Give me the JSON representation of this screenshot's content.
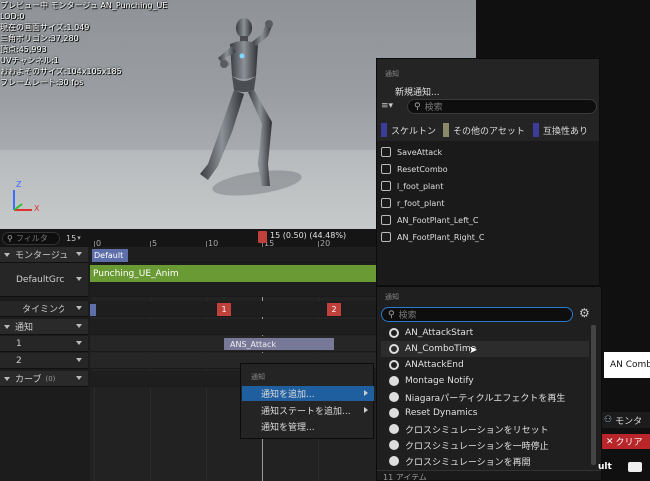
{
  "viewport": {
    "stats": [
      "プレビュー中 モンタージュ AN_Punching_UE",
      "LOD:0",
      "現在の画面サイズ:1.049",
      "三角ポリゴン:37,280",
      "頂点:45,993",
      "UVチャンネル:1",
      "おおよそのサイズ:104x105x185",
      "フレームレート:30 fps"
    ],
    "axis_labels": {
      "z": "Z",
      "x": "X"
    }
  },
  "tracks": {
    "filter_placeholder": "フィルタ",
    "frame_field": "15",
    "items": [
      {
        "label": "モンタージュ"
      },
      {
        "label": "DefaultGrc"
      },
      {
        "label": "タイミング"
      },
      {
        "label": "通知"
      },
      {
        "label": "1"
      },
      {
        "label": "2"
      },
      {
        "label": "カーブ",
        "count": "(0)"
      }
    ]
  },
  "timeline": {
    "ticks": [
      "0",
      "5",
      "10",
      "15",
      "20"
    ],
    "playhead_readout": "15 (0.50) (44.48%)",
    "section_label": "Default",
    "slot_clip": "Punching_UE_Anim",
    "timing_markers": [
      "1",
      "2"
    ],
    "state_notify": "ANS_Attack"
  },
  "notify_panel": {
    "header": "通知",
    "new_notify": "新規通知...",
    "search_placeholder": "検索",
    "filters": [
      {
        "label": "スケルトン",
        "color": "#3c3c9a"
      },
      {
        "label": "その他のアセット",
        "color": "#8a8a6a"
      },
      {
        "label": "互換性あり",
        "color": "#3c3c9a"
      }
    ],
    "items": [
      "SaveAttack",
      "ResetCombo",
      "l_foot_plant",
      "r_foot_plant",
      "AN_FootPlant_Left_C",
      "AN_FootPlant_Right_C"
    ]
  },
  "context_menu": {
    "header": "通知",
    "items": [
      {
        "label": "通知を追加...",
        "submenu": true,
        "selected": true
      },
      {
        "label": "通知ステートを追加...",
        "submenu": true
      },
      {
        "label": "通知を管理..."
      }
    ]
  },
  "submenu": {
    "header": "通知",
    "search_placeholder": "検索",
    "items": [
      {
        "label": "AN_AttackStart",
        "icon": "ring"
      },
      {
        "label": "AN_ComboTime",
        "icon": "ring",
        "hovered": true
      },
      {
        "label": "ANAttackEnd",
        "icon": "ring"
      },
      {
        "label": "Montage Notify",
        "icon": "dot"
      },
      {
        "label": "Niagaraパーティクルエフェクトを再生",
        "icon": "dot"
      },
      {
        "label": "Reset Dynamics",
        "icon": "dot"
      },
      {
        "label": "クロスシミュレーションをリセット",
        "icon": "dot"
      },
      {
        "label": "クロスシミュレーションを一時停止",
        "icon": "dot"
      },
      {
        "label": "クロスシミュレーションを再開",
        "icon": "dot"
      }
    ],
    "footer": "11 アイテム"
  },
  "right_side": {
    "tooltip": "AN Combo",
    "montage_tab": "モンタ",
    "clear_button": "クリア",
    "partial_label": "ult"
  },
  "colors": {
    "accent_blue": "#1f5fa0",
    "section_blue": "#5d6ea8",
    "slot_green": "#6a9a34",
    "marker_red": "#c0403c",
    "state_notify_purple": "#787898"
  }
}
